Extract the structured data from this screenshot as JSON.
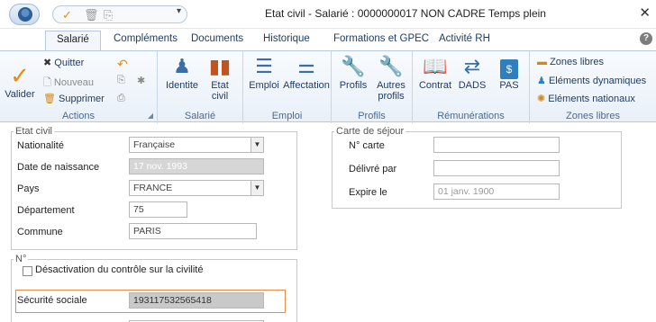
{
  "window": {
    "title": "Etat civil - Salarié : 0000000017 NON CADRE Temps plein",
    "close_icon": "close-icon"
  },
  "tabs": [
    "Salarié",
    "Compléments",
    "Documents",
    "Historique",
    "Formations et GPEC",
    "Activité RH"
  ],
  "ribbon": {
    "actions": {
      "label": "Actions",
      "valider": "Valider",
      "quitter": "Quitter",
      "nouveau": "Nouveau",
      "supprimer": "Supprimer"
    },
    "salarie": {
      "label": "Salarié",
      "identite": "Identite",
      "etat_civil_1": "Etat",
      "etat_civil_2": "civil"
    },
    "emploi": {
      "label": "Emploi",
      "emploi": "Emploi",
      "affectation": "Affectation"
    },
    "profils": {
      "label": "Profils",
      "profils": "Profils",
      "autres_1": "Autres",
      "autres_2": "profils"
    },
    "remunerations": {
      "label": "Rémunérations",
      "contrat": "Contrat",
      "dads": "DADS",
      "pas": "PAS"
    },
    "zones": {
      "label": "Zones libres",
      "zones_libres": "Zones libres",
      "elements_dynamiques": "Eléments dynamiques",
      "elements_nationaux": "Eléments nationaux"
    }
  },
  "etat_civil": {
    "legend": "Etat civil",
    "nationalite_label": "Nationalité",
    "nationalite_value": "Française",
    "date_naissance_label": "Date de naissance",
    "date_naissance_value": "17 nov. 1993",
    "pays_label": "Pays",
    "pays_value": "FRANCE",
    "departement_label": "Département",
    "departement_value": "75",
    "commune_label": "Commune",
    "commune_value": "PARIS"
  },
  "carte_sejour": {
    "legend": "Carte de séjour",
    "numero_label": "N° carte",
    "delivre_label": "Délivré par",
    "expire_label": "Expire le",
    "expire_placeholder": "01 janv. 1900"
  },
  "numero": {
    "legend": "N°",
    "desactivation_label": "Désactivation du contrôle sur la civilité",
    "secu_label": "Sécurité sociale",
    "secu_value": "193117532565418"
  }
}
